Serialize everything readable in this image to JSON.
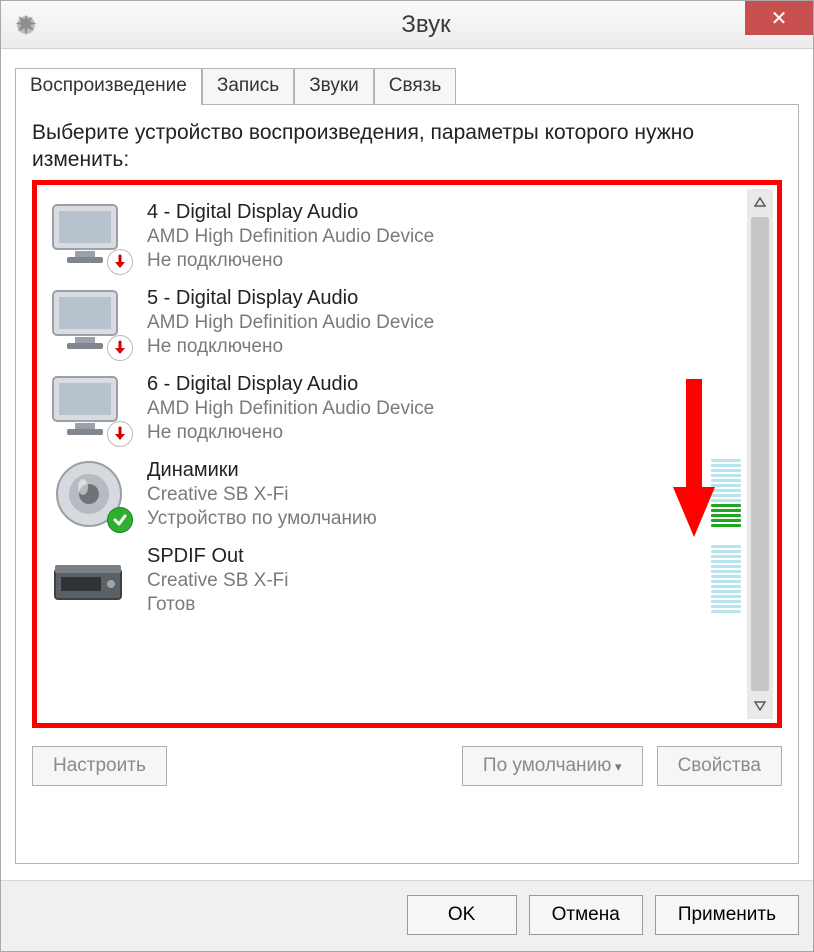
{
  "window": {
    "title": "Звук",
    "close_tooltip": "Close"
  },
  "tabs": [
    {
      "label": "Воспроизведение",
      "active": true
    },
    {
      "label": "Запись",
      "active": false
    },
    {
      "label": "Звуки",
      "active": false
    },
    {
      "label": "Связь",
      "active": false
    }
  ],
  "instruction": "Выберите устройство воспроизведения, параметры которого нужно изменить:",
  "devices": [
    {
      "name": "4 - Digital Display Audio",
      "desc": "AMD High Definition Audio Device",
      "status": "Не подключено",
      "icon": "monitor",
      "badge": "disconnected",
      "meter_total": 0,
      "meter_active": 0
    },
    {
      "name": "5 - Digital Display Audio",
      "desc": "AMD High Definition Audio Device",
      "status": "Не подключено",
      "icon": "monitor",
      "badge": "disconnected",
      "meter_total": 0,
      "meter_active": 0
    },
    {
      "name": "6 - Digital Display Audio",
      "desc": "AMD High Definition Audio Device",
      "status": "Не подключено",
      "icon": "monitor",
      "badge": "disconnected",
      "meter_total": 0,
      "meter_active": 0
    },
    {
      "name": "Динамики",
      "desc": "Creative SB X-Fi",
      "status": "Устройство по умолчанию",
      "icon": "speaker",
      "badge": "default",
      "meter_total": 14,
      "meter_active": 5
    },
    {
      "name": "SPDIF Out",
      "desc": "Creative SB X-Fi",
      "status": "Готов",
      "icon": "spdif",
      "badge": "none",
      "meter_total": 14,
      "meter_active": 0
    }
  ],
  "buttons": {
    "configure": "Настроить",
    "set_default": "По умолчанию",
    "properties": "Свойства",
    "ok": "OK",
    "cancel": "Отмена",
    "apply": "Применить"
  }
}
